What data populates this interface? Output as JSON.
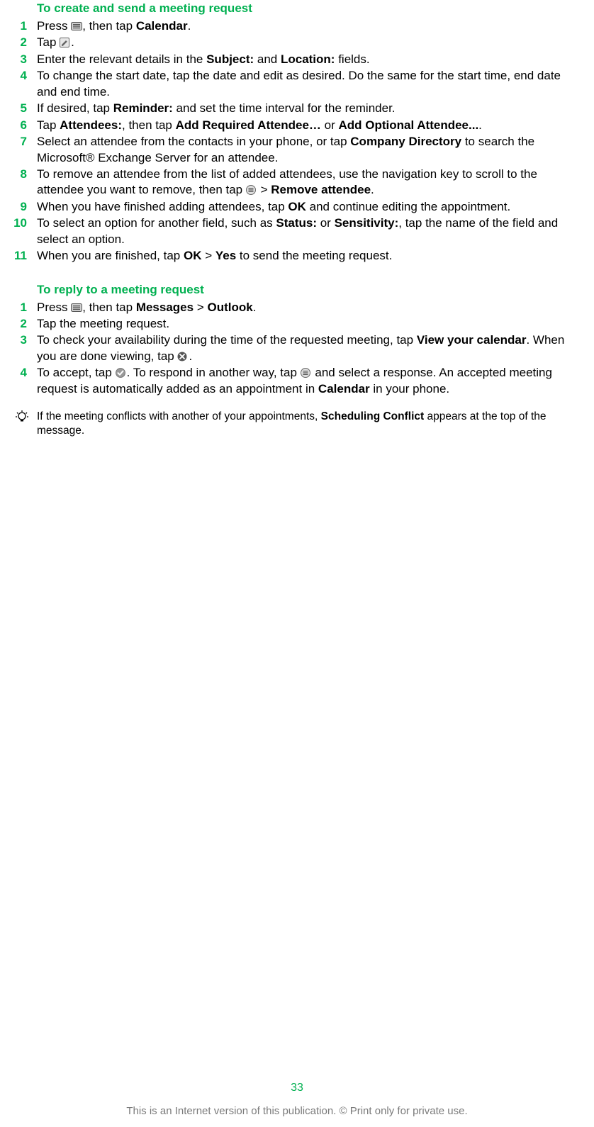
{
  "section1": {
    "heading": "To create and send a meeting request",
    "steps": [
      {
        "num": "1",
        "parts": [
          "Press ",
          {
            "icon": "menu-key-icon"
          },
          ", then tap ",
          {
            "b": "Calendar"
          },
          "."
        ]
      },
      {
        "num": "2",
        "parts": [
          "Tap ",
          {
            "icon": "edit-icon"
          },
          "."
        ]
      },
      {
        "num": "3",
        "parts": [
          "Enter the relevant details in the ",
          {
            "b": "Subject:"
          },
          " and ",
          {
            "b": "Location:"
          },
          " fields."
        ]
      },
      {
        "num": "4",
        "parts": [
          "To change the start date, tap the date and edit as desired. Do the same for the start time, end date and end time."
        ]
      },
      {
        "num": "5",
        "parts": [
          "If desired, tap ",
          {
            "b": "Reminder:"
          },
          " and set the time interval for the reminder."
        ]
      },
      {
        "num": "6",
        "parts": [
          "Tap ",
          {
            "b": "Attendees:"
          },
          ", then tap ",
          {
            "b": "Add Required Attendee…"
          },
          " or ",
          {
            "b": "Add Optional Attendee..."
          },
          "."
        ]
      },
      {
        "num": "7",
        "parts": [
          "Select an attendee from the contacts in your phone, or tap ",
          {
            "b": "Company Directory"
          },
          " to search the Microsoft® Exchange Server for an attendee."
        ]
      },
      {
        "num": "8",
        "parts": [
          "To remove an attendee from the list of added attendees, use the navigation key to scroll to the attendee you want to remove, then tap ",
          {
            "icon": "list-menu-icon"
          },
          " > ",
          {
            "b": "Remove attendee"
          },
          "."
        ]
      },
      {
        "num": "9",
        "parts": [
          "When you have finished adding attendees, tap ",
          {
            "b": "OK"
          },
          " and continue editing the appointment."
        ]
      },
      {
        "num": "10",
        "parts": [
          "To select an option for another field, such as ",
          {
            "b": "Status:"
          },
          " or ",
          {
            "b": "Sensitivity:"
          },
          ", tap the name of the field and select an option."
        ]
      },
      {
        "num": "11",
        "parts": [
          "When you are finished, tap ",
          {
            "b": "OK"
          },
          " > ",
          {
            "b": "Yes"
          },
          " to send the meeting request."
        ]
      }
    ]
  },
  "section2": {
    "heading": "To reply to a meeting request",
    "steps": [
      {
        "num": "1",
        "parts": [
          "Press ",
          {
            "icon": "menu-key-icon"
          },
          ", then tap ",
          {
            "b": "Messages"
          },
          " > ",
          {
            "b": "Outlook"
          },
          "."
        ]
      },
      {
        "num": "2",
        "parts": [
          "Tap the meeting request."
        ]
      },
      {
        "num": "3",
        "parts": [
          "To check your availability during the time of the requested meeting, tap ",
          {
            "b": "View your calendar"
          },
          ". When you are done viewing, tap ",
          {
            "icon": "close-icon"
          },
          "."
        ]
      },
      {
        "num": "4",
        "parts": [
          "To accept, tap ",
          {
            "icon": "accept-icon"
          },
          ". To respond in another way, tap ",
          {
            "icon": "list-menu-icon"
          },
          " and select a response. An accepted meeting request is automatically added as an appointment in ",
          {
            "b": "Calendar"
          },
          " in your phone."
        ]
      }
    ]
  },
  "tip": {
    "parts": [
      "If the meeting conflicts with another of your appointments, ",
      {
        "b": "Scheduling Conflict"
      },
      " appears at the top of the message."
    ]
  },
  "page_number": "33",
  "footer": "This is an Internet version of this publication. © Print only for private use."
}
